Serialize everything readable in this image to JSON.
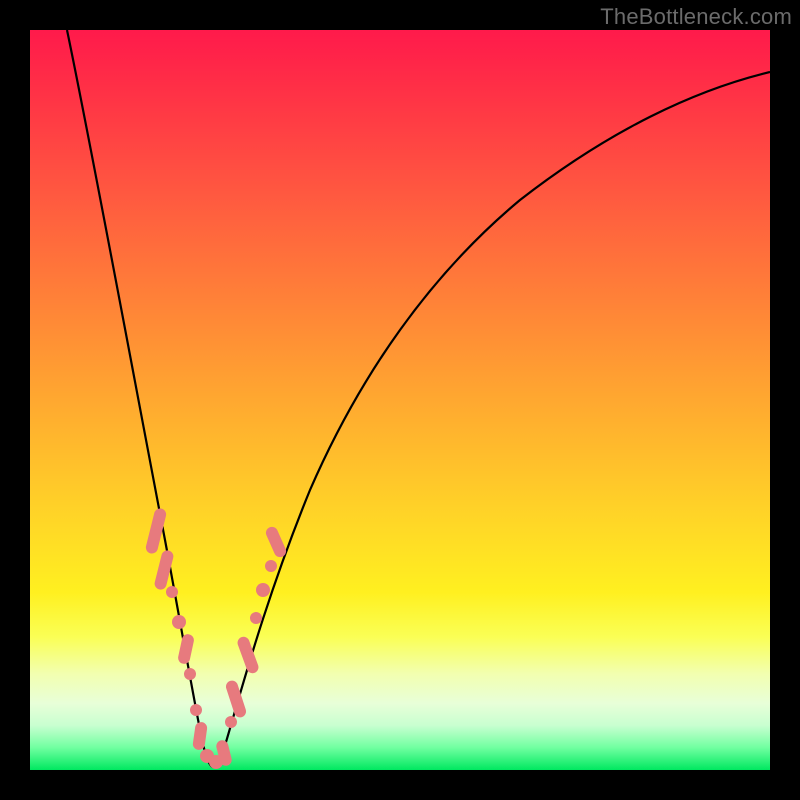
{
  "watermark": {
    "text": "TheBottleneck.com"
  },
  "colors": {
    "bead": "#e77a7e",
    "curve": "#000000",
    "gradient_top": "#ff1a4b",
    "gradient_bottom": "#00e860"
  },
  "chart_data": {
    "type": "line",
    "title": "",
    "xlabel": "",
    "ylabel": "",
    "xlim": [
      0,
      100
    ],
    "ylim": [
      0,
      100
    ],
    "grid": false,
    "legend": false,
    "notes": "No axis ticks or numeric labels visible; values estimated from curve geometry. y=0 is bottom (green), y=100 is top (red). Minimum of V-curve near x≈24.",
    "series": [
      {
        "name": "bottleneck-curve",
        "x": [
          5,
          8,
          11,
          14,
          17,
          20,
          22,
          23,
          24,
          25,
          26,
          28,
          31,
          35,
          40,
          46,
          53,
          61,
          70,
          80,
          90,
          100
        ],
        "y": [
          100,
          86,
          72,
          58,
          44,
          28,
          14,
          6,
          1,
          0.5,
          2,
          10,
          24,
          40,
          54,
          65,
          73,
          79,
          84,
          88,
          91,
          93
        ]
      }
    ],
    "bead_clusters": [
      {
        "name": "left-arm-upper",
        "count": 5,
        "approx_x_range": [
          17.5,
          19.5
        ],
        "approx_y_range": [
          24,
          36
        ]
      },
      {
        "name": "left-arm-mid",
        "count": 2,
        "approx_x_range": [
          20.5,
          21.5
        ],
        "approx_y_range": [
          15,
          20
        ]
      },
      {
        "name": "valley",
        "count": 5,
        "approx_x_range": [
          22.5,
          26.5
        ],
        "approx_y_range": [
          0.5,
          4
        ]
      },
      {
        "name": "right-arm-mid",
        "count": 4,
        "approx_x_range": [
          27.5,
          29.5
        ],
        "approx_y_range": [
          9,
          20
        ]
      },
      {
        "name": "right-arm-upper",
        "count": 2,
        "approx_x_range": [
          30.5,
          32.0
        ],
        "approx_y_range": [
          25,
          32
        ]
      }
    ]
  }
}
